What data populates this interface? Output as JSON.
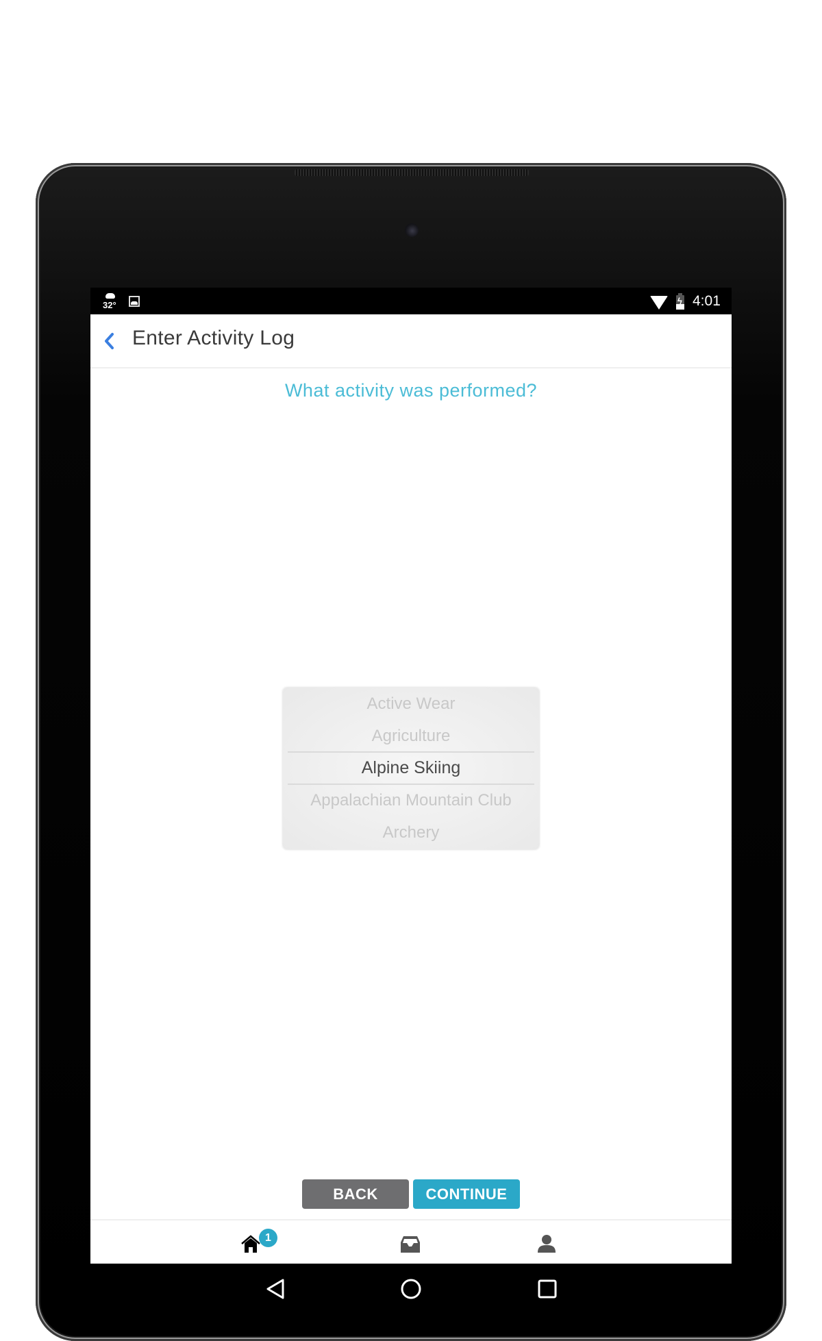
{
  "status_bar": {
    "weather_temp": "32°",
    "weather_icon": "cloud-icon",
    "notification_icon": "image-icon",
    "wifi_icon": "wifi-icon",
    "battery_icon": "battery-charging-icon",
    "time": "4:01"
  },
  "header": {
    "back_icon": "chevron-left-icon",
    "title": "Enter Activity Log",
    "accent_color": "#3b7fe0"
  },
  "main": {
    "question": "What activity was performed?",
    "picker": {
      "items": [
        "Active Wear",
        "Agriculture",
        "Alpine Skiing",
        "Appalachian Mountain Club",
        "Archery"
      ],
      "selected": "Alpine Skiing"
    }
  },
  "actions": {
    "back_label": "BACK",
    "continue_label": "CONTINUE",
    "back_color": "#6e6e70",
    "continue_color": "#2ba8c8"
  },
  "tab_bar": {
    "tabs": [
      {
        "name": "home",
        "icon": "home-icon",
        "badge": "1"
      },
      {
        "name": "inbox",
        "icon": "inbox-icon"
      },
      {
        "name": "profile",
        "icon": "person-icon"
      }
    ]
  },
  "nav_bar": {
    "buttons": [
      "back-triangle-icon",
      "home-circle-icon",
      "recents-square-icon"
    ]
  }
}
